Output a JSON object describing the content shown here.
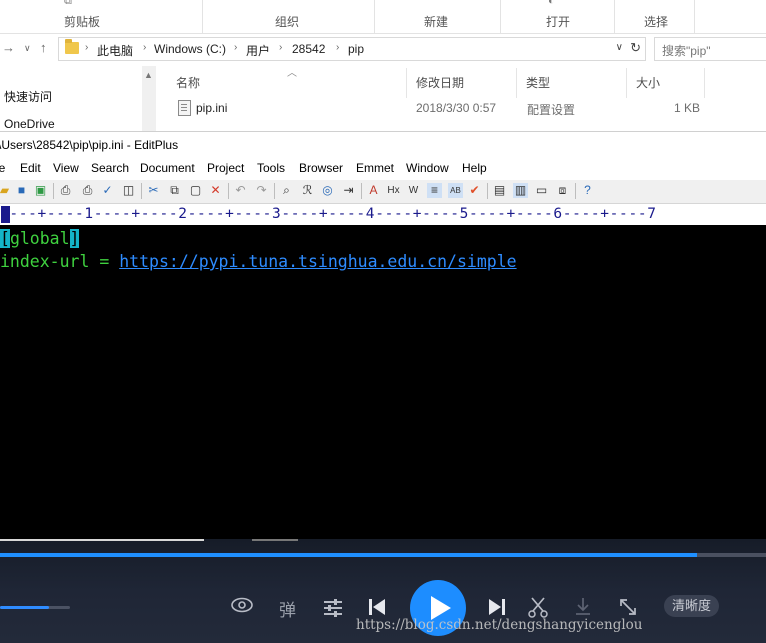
{
  "explorer": {
    "ribbon": {
      "groups": [
        {
          "label": "剪贴板"
        },
        {
          "label": "组织"
        },
        {
          "label": "新建"
        },
        {
          "label": "打开"
        },
        {
          "label": "选择"
        }
      ]
    },
    "address": {
      "crumbs": [
        "此电脑",
        "Windows (C:)",
        "用户",
        "28542",
        "pip"
      ],
      "search_placeholder": "搜索\"pip\""
    },
    "nav": {
      "items": [
        "快速访问",
        "OneDrive"
      ]
    },
    "columns": {
      "name": "名称",
      "modified": "修改日期",
      "type": "类型",
      "size": "大小"
    },
    "files": [
      {
        "name": "pip.ini",
        "modified": "2018/3/30 0:57",
        "type": "配置设置",
        "size": "1 KB"
      }
    ]
  },
  "editplus": {
    "title": "\\Users\\28542\\pip\\pip.ini - EditPlus",
    "menu": [
      "le",
      "Edit",
      "View",
      "Search",
      "Document",
      "Project",
      "Tools",
      "Browser",
      "Emmet",
      "Window",
      "Help"
    ],
    "ruler": "----+----1----+----2----+----3----+----4----+----5----+----6----+----7",
    "code": {
      "line1_open": "[",
      "line1_word": "global",
      "line1_close": "]",
      "line2_key": "index-url = ",
      "line2_url": "https://pypi.tuna.tsinghua.edu.cn/simple"
    }
  },
  "player": {
    "progress": 0.91,
    "volume": 0.7,
    "controls": {
      "danmaku": "弹",
      "quality": "清晰度"
    },
    "accent": "#1d8dff"
  },
  "watermark": "https://blog.csdn.net/dengshangyicenglou"
}
